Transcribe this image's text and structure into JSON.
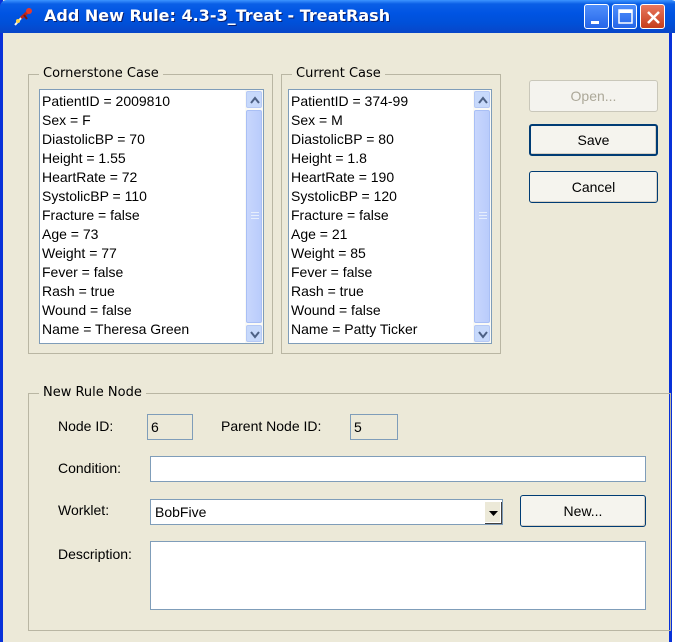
{
  "window": {
    "title": "Add New Rule: 4.3-3_Treat - TreatRash",
    "icon": "app-icon"
  },
  "cornerstone_case": {
    "label": "Cornerstone Case",
    "items": [
      "PatientID = 2009810",
      "Sex = F",
      "DiastolicBP = 70",
      "Height = 1.55",
      "HeartRate = 72",
      "SystolicBP = 110",
      "Fracture = false",
      "Age = 73",
      "Weight = 77",
      "Fever = false",
      "Rash = true",
      "Wound = false",
      "Name = Theresa Green"
    ]
  },
  "current_case": {
    "label": "Current Case",
    "items": [
      "PatientID = 374-99",
      "Sex = M",
      "DiastolicBP = 80",
      "Height = 1.8",
      "HeartRate = 190",
      "SystolicBP = 120",
      "Fracture = false",
      "Age = 21",
      "Weight = 85",
      "Fever = false",
      "Rash = true",
      "Wound = false",
      "Name = Patty Ticker"
    ]
  },
  "buttons": {
    "open": "Open...",
    "save": "Save",
    "cancel": "Cancel",
    "new": "New..."
  },
  "new_rule_node": {
    "label": "New Rule Node",
    "node_id_label": "Node ID:",
    "node_id": "6",
    "parent_node_id_label": "Parent Node ID:",
    "parent_node_id": "5",
    "condition_label": "Condition:",
    "condition": "",
    "worklet_label": "Worklet:",
    "worklet": "BobFive",
    "description_label": "Description:",
    "description": ""
  }
}
